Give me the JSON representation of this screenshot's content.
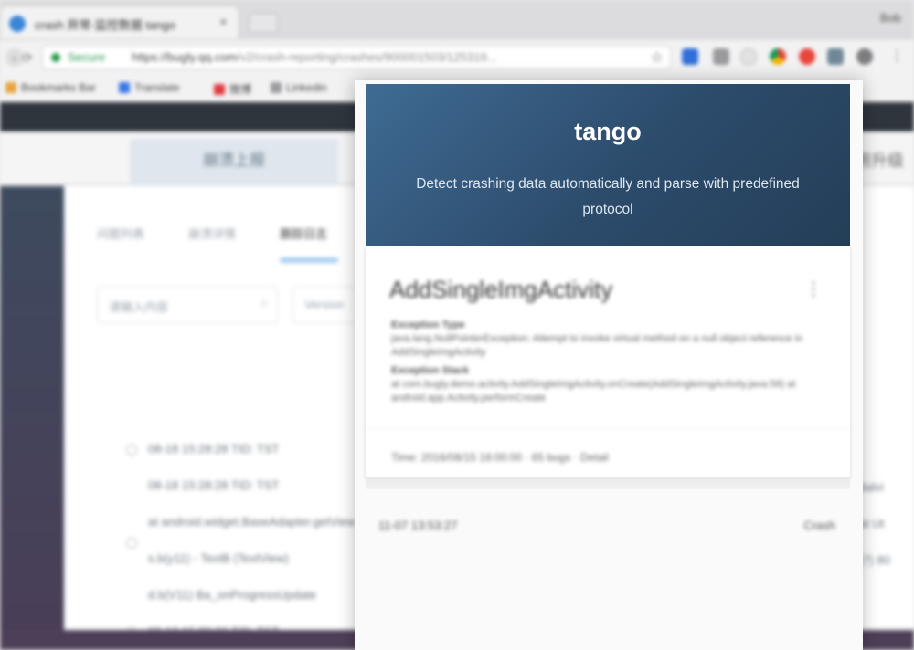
{
  "browser": {
    "tab_title": "crash 异常-监控数据 tango",
    "profile": "Bob",
    "secure_label": "Secure",
    "url_host": "https://bugly.qq.com",
    "url_path": "/v2/crash-reporting/crashes/900001503/125319...",
    "bookmarks": [
      "Bookmarks Bar",
      "Translate",
      "微博",
      "Linkedin"
    ]
  },
  "page": {
    "header_tab": "崩溃上报",
    "subtabs": [
      "问题列表",
      "崩溃详情",
      "跟踪日志"
    ],
    "filter_placeholder": "请输入内容",
    "filter2": "Version",
    "upgrade_text": "用升级",
    "rows": [
      "08-18 15:28:28 TID: TST",
      "08-18 15:28:28 TID: TST",
      "at android.widget.BaseAdapter.getView",
      "s.b(y11) - TextB (TextView)",
      "d.b(V11) Ba_onProgressUpdate",
      "08-18 15:28:28 TID: TST"
    ],
    "right_rows": [
      "dalvi",
      "at Ut",
      "(7) 80"
    ]
  },
  "popup": {
    "title": "tango",
    "description": "Detect crashing data automatically and parse with predefined protocol",
    "card": {
      "title": "AddSingleImgActivity",
      "menu_icon": "more-vert-icon",
      "field1_label": "Exception Type",
      "field1_value": "java.lang.NullPointerException: Attempt to invoke virtual method on a null object reference in AddSingleImgActivity",
      "field2_label": "Exception Stack",
      "field2_value": "at com.bugly.demo.activity.AddSingleImgActivity.onCreate(AddSingleImgActivity.java:58) at android.app.Activity.performCreate",
      "footer": "Time: 2016/08/15 18:00:00 · 65 bugs · Detail"
    },
    "history": {
      "left": "11-07 13:53:27",
      "right": "Crash"
    }
  }
}
